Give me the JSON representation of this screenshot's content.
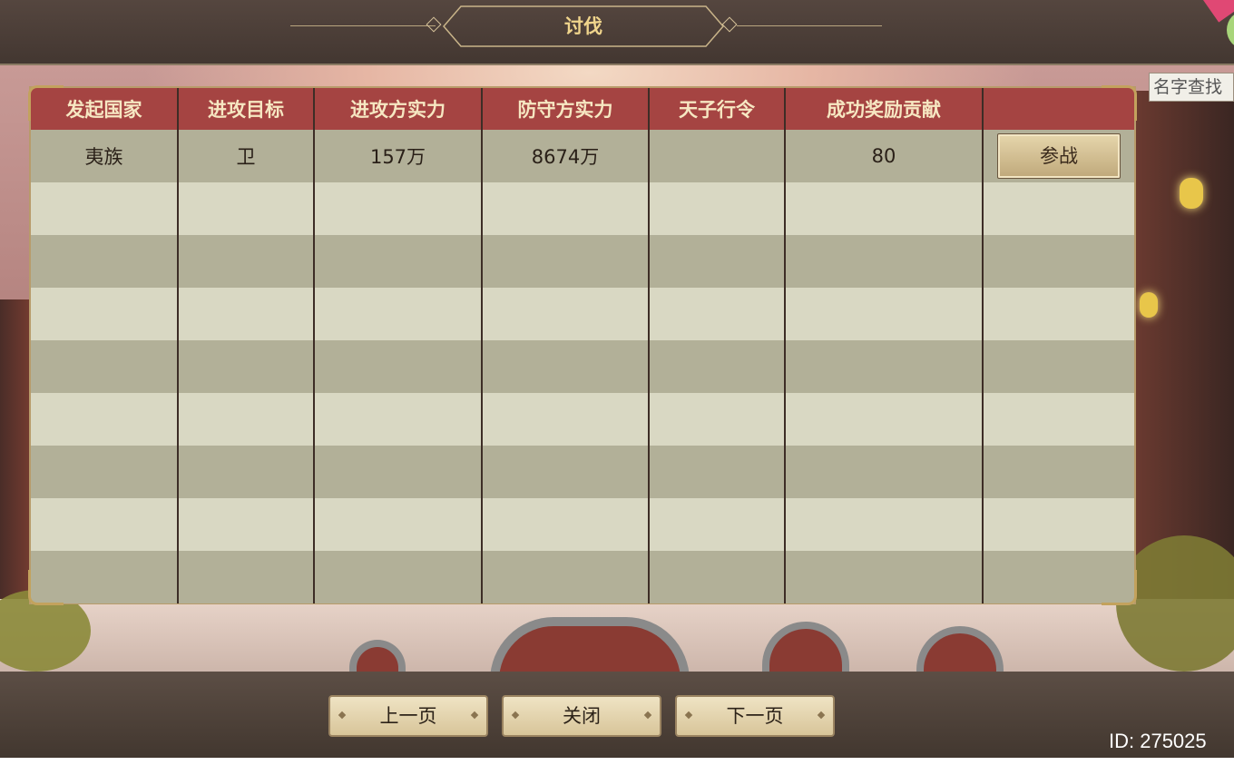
{
  "header": {
    "title": "讨伐"
  },
  "search": {
    "placeholder": "名字查找"
  },
  "table": {
    "columns": [
      "发起国家",
      "进攻目标",
      "进攻方实力",
      "防守方实力",
      "天子行令",
      "成功奖励贡献",
      ""
    ],
    "rows": [
      {
        "nation": "夷族",
        "target": "卫",
        "attack_power": "157万",
        "defense_power": "8674万",
        "decree": "",
        "reward": "80",
        "action": "参战"
      }
    ]
  },
  "footer": {
    "prev_label": "上一页",
    "close_label": "关闭",
    "next_label": "下一页",
    "id_text": "ID: 275025"
  }
}
